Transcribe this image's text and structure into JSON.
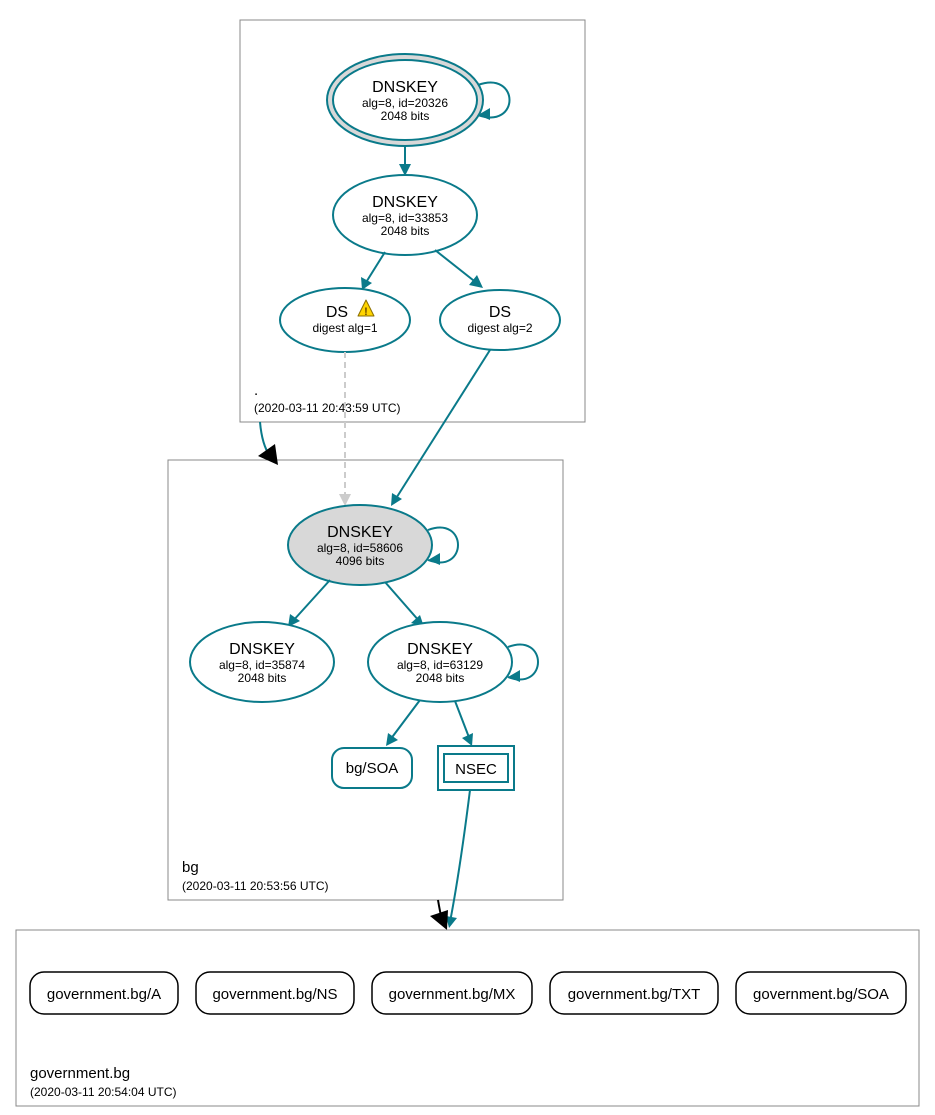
{
  "zones": {
    "root": {
      "name": ".",
      "timestamp": "(2020-03-11 20:43:59 UTC)"
    },
    "bg": {
      "name": "bg",
      "timestamp": "(2020-03-11 20:53:56 UTC)"
    },
    "government_bg": {
      "name": "government.bg",
      "timestamp": "(2020-03-11 20:54:04 UTC)"
    }
  },
  "nodes": {
    "root_ksk": {
      "title": "DNSKEY",
      "sub1": "alg=8, id=20326",
      "sub2": "2048 bits"
    },
    "root_zsk": {
      "title": "DNSKEY",
      "sub1": "alg=8, id=33853",
      "sub2": "2048 bits"
    },
    "ds1": {
      "title": "DS",
      "sub1": "digest alg=1"
    },
    "ds2": {
      "title": "DS",
      "sub1": "digest alg=2"
    },
    "bg_ksk": {
      "title": "DNSKEY",
      "sub1": "alg=8, id=58606",
      "sub2": "4096 bits"
    },
    "bg_zsk1": {
      "title": "DNSKEY",
      "sub1": "alg=8, id=35874",
      "sub2": "2048 bits"
    },
    "bg_zsk2": {
      "title": "DNSKEY",
      "sub1": "alg=8, id=63129",
      "sub2": "2048 bits"
    },
    "bg_soa": {
      "label": "bg/SOA"
    },
    "nsec": {
      "label": "NSEC"
    }
  },
  "rrsets": {
    "a": {
      "label": "government.bg/A"
    },
    "ns": {
      "label": "government.bg/NS"
    },
    "mx": {
      "label": "government.bg/MX"
    },
    "txt": {
      "label": "government.bg/TXT"
    },
    "soa": {
      "label": "government.bg/SOA"
    }
  }
}
